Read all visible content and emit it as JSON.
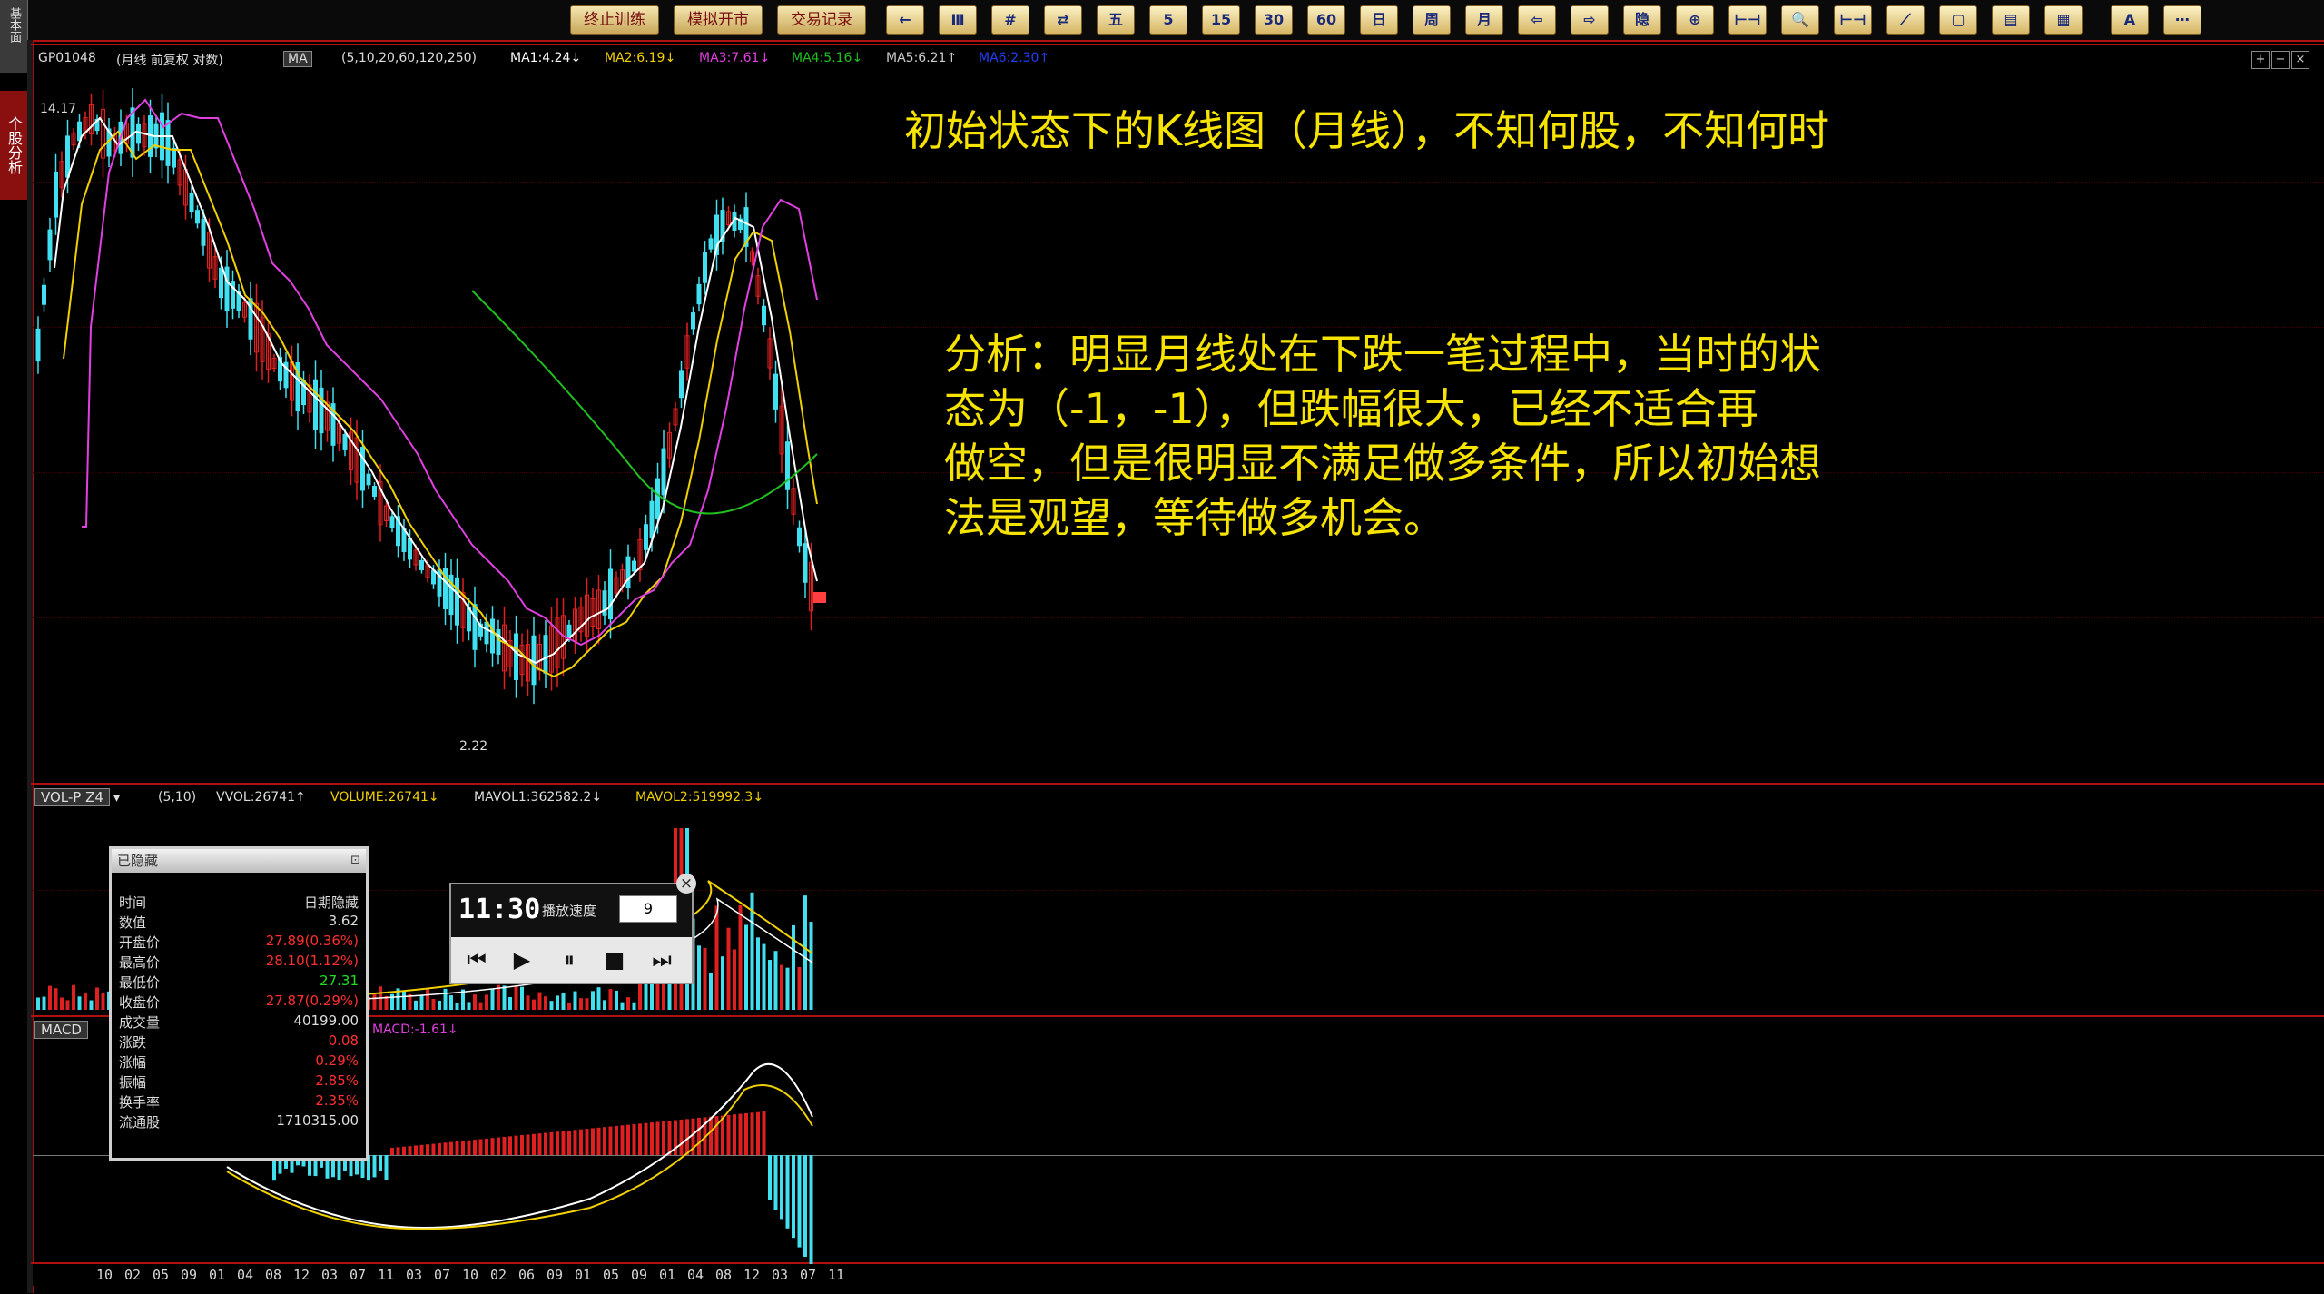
{
  "toolbar": {
    "buttons": [
      "终止训练",
      "模拟开市",
      "交易记录"
    ],
    "icons": [
      "←",
      "Ⅲ",
      "#",
      "⇄",
      "五",
      "5",
      "15",
      "30",
      "60",
      "日",
      "周",
      "月",
      "⇦",
      "⇨",
      "隐",
      "⊕",
      "⊢⊣",
      "🔍",
      "⊢⊣",
      "⟋",
      "▢",
      "▤",
      "▦",
      "A",
      "⋯"
    ]
  },
  "side_tab": {
    "label": "个股分析"
  },
  "side_tab_top": {
    "label": "基本面"
  },
  "price_panel": {
    "code": "GP01048",
    "period": "(月线 前复权 对数)",
    "indicator": "MA",
    "params": "(5,10,20,60,120,250)",
    "ma1": "MA1:4.24↓",
    "ma2": "MA2:6.19↓",
    "ma3": "MA3:7.61↓",
    "ma4": "MA4:5.16↓",
    "ma5": "MA5:6.21↑",
    "ma6": "MA6:2.30↑",
    "high_label": "14.17",
    "low_label": "2.22",
    "colors": {
      "ma1": "#ffffff",
      "ma2": "#f0d000",
      "ma3": "#e040e0",
      "ma4": "#20c020",
      "ma5": "#cccccc",
      "ma6": "#2040ff"
    }
  },
  "annotation": {
    "title": "初始状态下的K线图（月线），不知何股，不知何时",
    "analysis": [
      "分析：明显月线处在下跌一笔过程中，当时的状",
      "态为（-1，-1），但跌幅很大，已经不适合再",
      "做空，但是很明显不满足做多条件，所以初始想",
      "法是观望，等待做多机会。"
    ]
  },
  "volume_panel": {
    "indicator": "VOL-P Z4",
    "params": "(5,10)",
    "vvol": "VVOL:26741↑",
    "volume": "VOLUME:26741↓",
    "mavol1": "MAVOL1:362582.2↓",
    "mavol2": "MAVOL2:519992.3↓"
  },
  "macd_panel": {
    "indicator": "MACD",
    "macd_value": "MACD:-1.61↓"
  },
  "data_window": {
    "title": "已隐藏",
    "rows": [
      {
        "k": "时间",
        "v": "日期隐藏",
        "c": "#dddddd"
      },
      {
        "k": "数值",
        "v": "3.62",
        "c": "#dddddd"
      },
      {
        "k": "开盘价",
        "v": "27.89(0.36%)",
        "c": "#ff3030"
      },
      {
        "k": "最高价",
        "v": "28.10(1.12%)",
        "c": "#ff3030"
      },
      {
        "k": "最低价",
        "v": "27.31",
        "c": "#20e020"
      },
      {
        "k": "收盘价",
        "v": "27.87(0.29%)",
        "c": "#ff3030"
      },
      {
        "k": "成交量",
        "v": "40199.00",
        "c": "#dddddd"
      },
      {
        "k": "涨跌",
        "v": "0.08",
        "c": "#ff3030"
      },
      {
        "k": "涨幅",
        "v": "0.29%",
        "c": "#ff3030"
      },
      {
        "k": "振幅",
        "v": "2.85%",
        "c": "#ff3030"
      },
      {
        "k": "换手率",
        "v": "2.35%",
        "c": "#ff3030"
      },
      {
        "k": "流通股",
        "v": "1710315.00",
        "c": "#dddddd"
      }
    ]
  },
  "player": {
    "time": "11:30",
    "speed_label": "播放速度",
    "speed": "9"
  },
  "axis": {
    "labels": [
      "10",
      "02",
      "05",
      "09",
      "01",
      "04",
      "08",
      "12",
      "03",
      "07",
      "11",
      "03",
      "07",
      "10",
      "02",
      "06",
      "09",
      "01",
      "05",
      "09",
      "01",
      "04",
      "08",
      "12",
      "03",
      "07",
      "11"
    ]
  }
}
